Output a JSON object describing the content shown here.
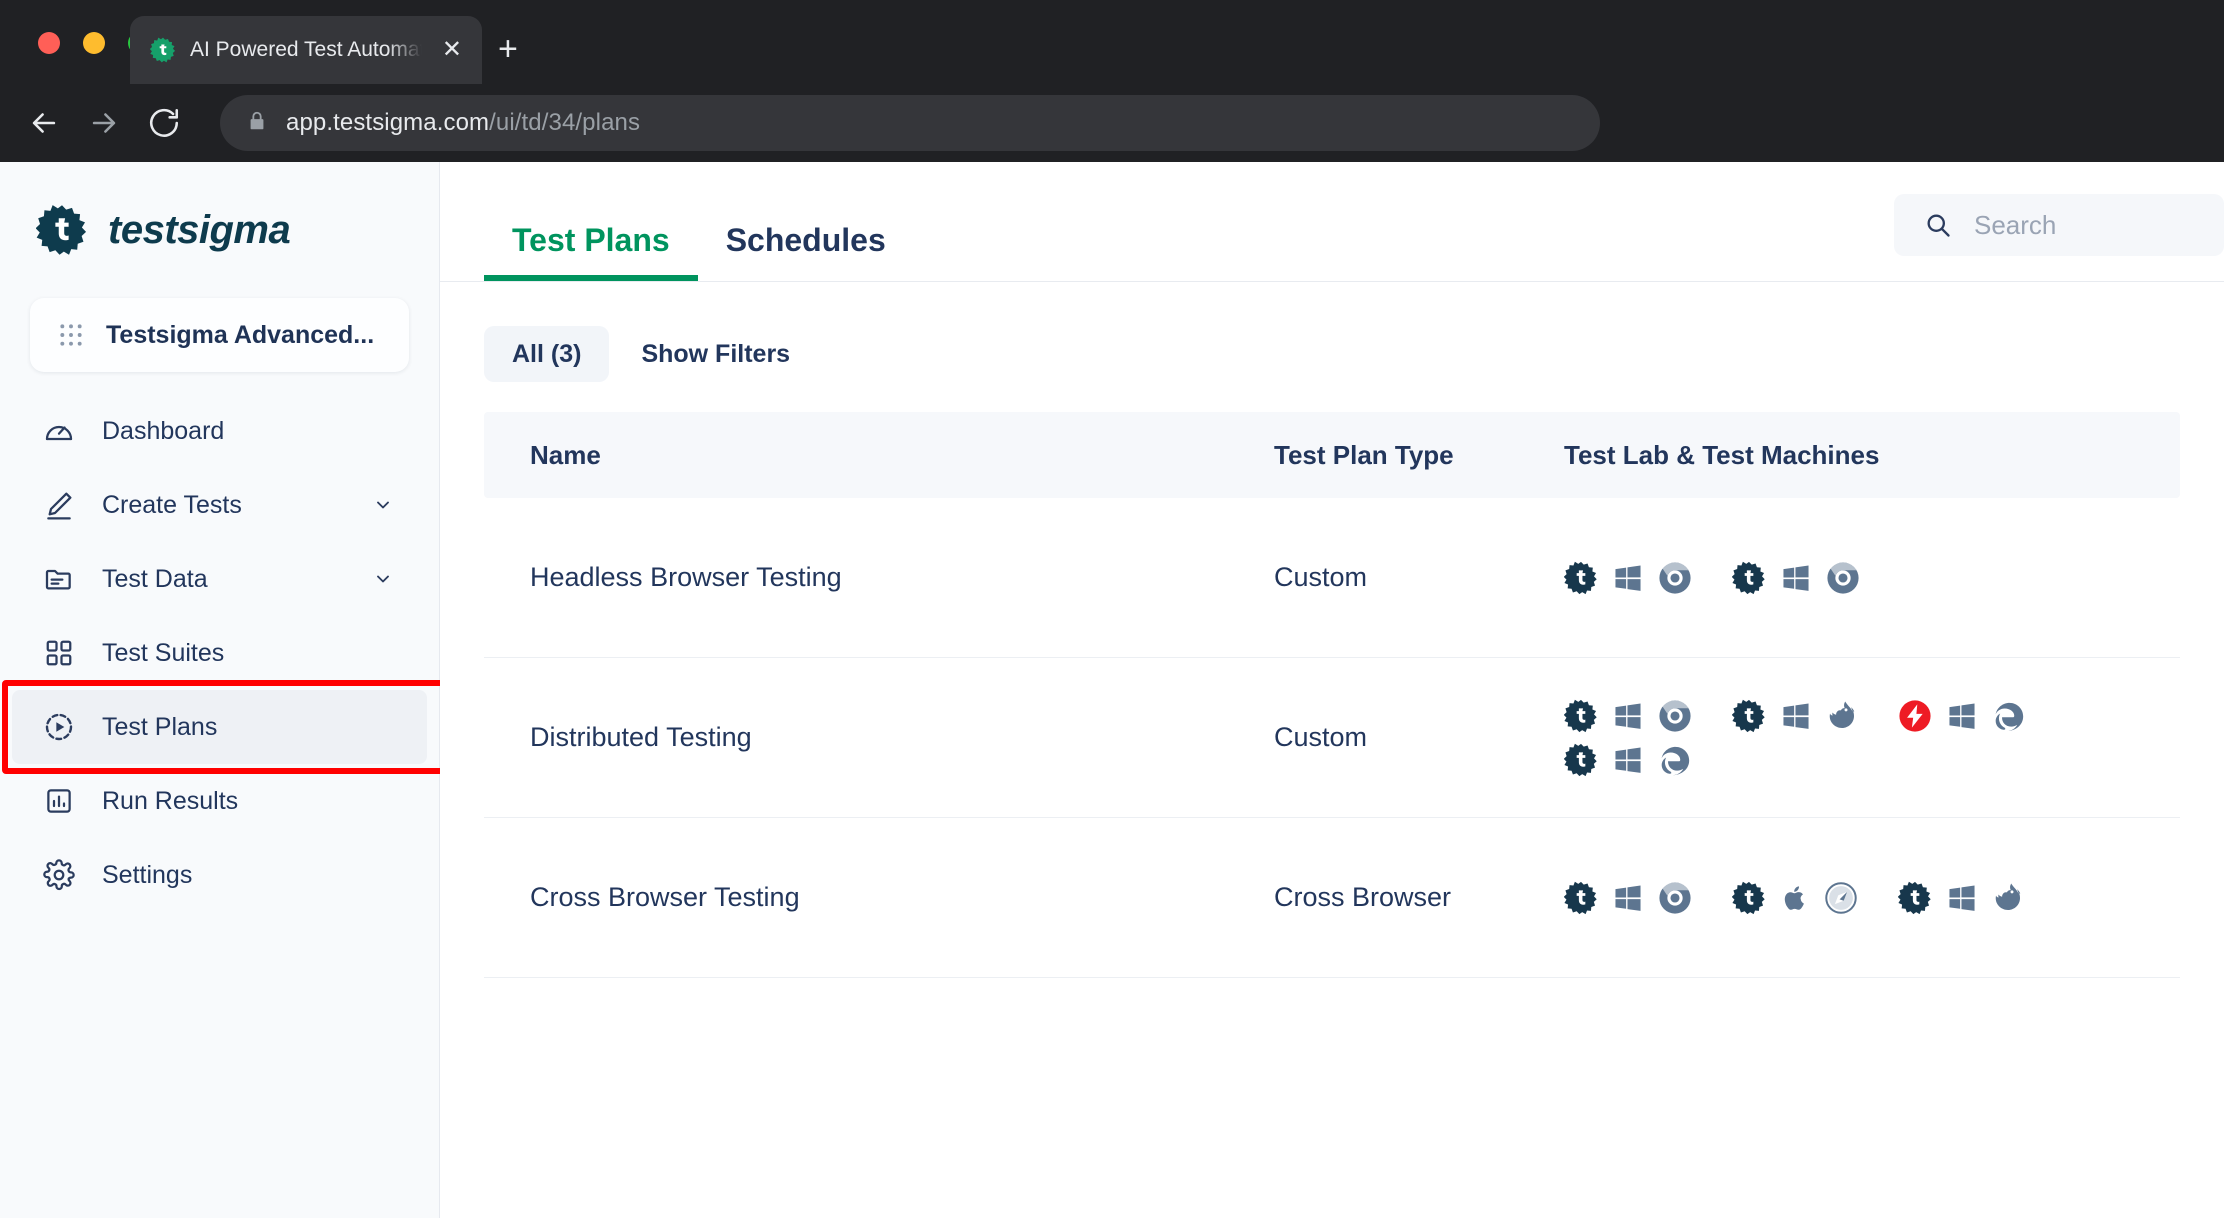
{
  "browser": {
    "tab": {
      "title": "AI Powered Test Automation Pl",
      "favicon_icon": "testsigma-gear-icon",
      "close_icon": "close-icon"
    },
    "new_tab_icon": "plus-icon",
    "nav": {
      "back_icon": "arrow-left-icon",
      "forward_icon": "arrow-right-icon",
      "reload_icon": "reload-icon"
    },
    "address": {
      "lock_icon": "lock-icon",
      "host": "app.testsigma.com",
      "path": "/ui/td/34/plans"
    }
  },
  "sidebar": {
    "brand": {
      "logo_icon": "testsigma-gear-icon",
      "name": "testsigma"
    },
    "project": {
      "icon": "grid-apps-icon",
      "label": "Testsigma Advanced..."
    },
    "items": [
      {
        "label": "Dashboard",
        "icon": "speedometer-icon",
        "has_chevron": false,
        "active": false,
        "highlighted": false
      },
      {
        "label": "Create Tests",
        "icon": "pencil-icon",
        "has_chevron": true,
        "active": false,
        "highlighted": false
      },
      {
        "label": "Test Data",
        "icon": "folder-lines-icon",
        "has_chevron": true,
        "active": false,
        "highlighted": false
      },
      {
        "label": "Test Suites",
        "icon": "grid-squares-icon",
        "has_chevron": false,
        "active": false,
        "highlighted": false
      },
      {
        "label": "Test Plans",
        "icon": "play-circle-icon",
        "has_chevron": false,
        "active": true,
        "highlighted": true
      },
      {
        "label": "Run Results",
        "icon": "bar-chart-icon",
        "has_chevron": false,
        "active": false,
        "highlighted": false
      },
      {
        "label": "Settings",
        "icon": "gear-icon",
        "has_chevron": false,
        "active": false,
        "highlighted": false
      }
    ]
  },
  "main": {
    "tabs": [
      {
        "label": "Test Plans",
        "active": true
      },
      {
        "label": "Schedules",
        "active": false
      }
    ],
    "search": {
      "icon": "search-icon",
      "placeholder": "Search",
      "value": ""
    },
    "filters": {
      "all_chip": "All (3)",
      "show_filters": "Show Filters"
    },
    "table": {
      "columns": [
        "Name",
        "Test Plan Type",
        "Test Lab & Test Machines"
      ],
      "rows": [
        {
          "name": "Headless Browser Testing",
          "type": "Custom",
          "machines": [
            [
              "testsigma-lab-icon",
              "windows-icon",
              "chrome-icon"
            ],
            [
              "testsigma-lab-icon",
              "windows-icon",
              "chrome-icon"
            ]
          ]
        },
        {
          "name": "Distributed Testing",
          "type": "Custom",
          "machines": [
            [
              "testsigma-lab-icon",
              "windows-icon",
              "chrome-icon"
            ],
            [
              "testsigma-lab-icon",
              "windows-icon",
              "firefox-icon"
            ],
            [
              "lambdatest-icon",
              "windows-icon",
              "edge-icon"
            ],
            [
              "testsigma-lab-icon",
              "windows-icon",
              "edge-icon"
            ]
          ]
        },
        {
          "name": "Cross Browser Testing",
          "type": "Cross Browser",
          "machines": [
            [
              "testsigma-lab-icon",
              "windows-icon",
              "chrome-icon"
            ],
            [
              "testsigma-lab-icon",
              "apple-icon",
              "safari-icon"
            ],
            [
              "testsigma-lab-icon",
              "windows-icon",
              "firefox-icon"
            ]
          ]
        }
      ]
    }
  },
  "colors": {
    "accent_green": "#00945e",
    "brand_dark": "#0e3b4d",
    "text_navy": "#22365c",
    "icon_slate": "#5d7590",
    "lambdatest_red": "#ee1b24",
    "highlight_red": "#ff0000"
  }
}
